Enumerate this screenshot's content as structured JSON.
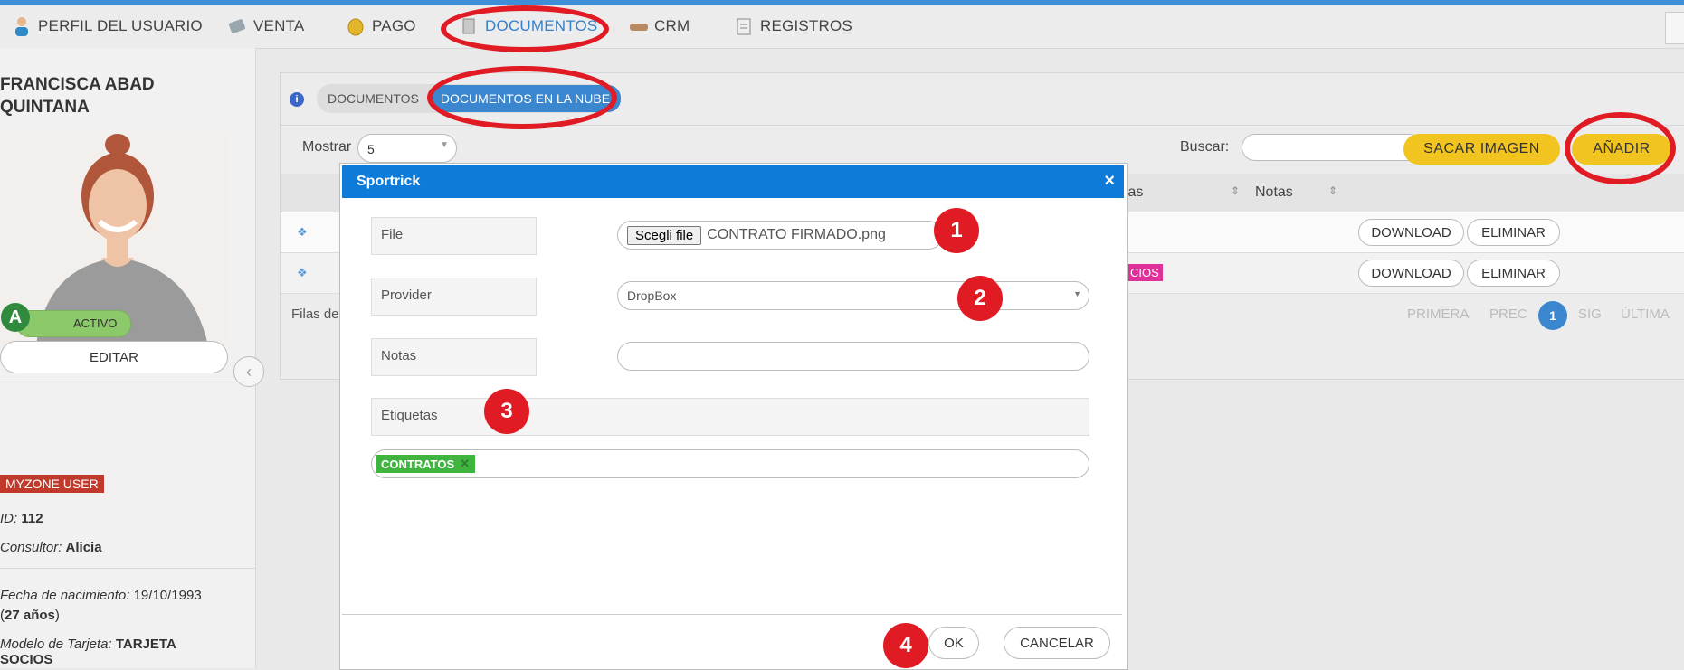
{
  "nav": {
    "items": [
      {
        "label": "PERFIL DEL USUARIO",
        "icon": "user-icon"
      },
      {
        "label": "VENTA",
        "icon": "sale-icon"
      },
      {
        "label": "PAGO",
        "icon": "coin-icon"
      },
      {
        "label": "DOCUMENTOS",
        "icon": "document-icon"
      },
      {
        "label": "CRM",
        "icon": "handshake-icon"
      },
      {
        "label": "REGISTROS",
        "icon": "log-icon"
      }
    ]
  },
  "user": {
    "name": "FRANCISCA ABAD QUINTANA",
    "avatar_letter": "A",
    "status": "ACTIVO",
    "edit_label": "EDITAR",
    "tag": "MYZONE USER",
    "id_label": "ID:",
    "id_value": "112",
    "consultor_label": "Consultor:",
    "consultor_value": "Alicia",
    "birth_label": "Fecha de nacimiento:",
    "birth_value": "19/10/1993",
    "age_value": "27 años",
    "card_label": "Modelo de Tarjeta:",
    "card_value": "TARJETA SOCIOS"
  },
  "main": {
    "tabs": [
      "DOCUMENTOS",
      "DOCUMENTOS EN LA NUBE"
    ],
    "show_label": "Mostrar",
    "show_value": "5",
    "search_label": "Buscar:",
    "btn_snapshot": "SACAR IMAGEN",
    "btn_add": "AÑADIR",
    "columns": [
      "tas",
      "Notas"
    ],
    "rows": [
      {
        "tag": "",
        "download": "DOWNLOAD",
        "delete": "ELIMINAR"
      },
      {
        "tag": "CIOS",
        "download": "DOWNLOAD",
        "delete": "ELIMINAR"
      }
    ],
    "rows_label": "Filas de",
    "pager": {
      "first": "PRIMERA",
      "prev": "PREC",
      "current": "1",
      "next": "SIG",
      "last": "ÚLTIMA"
    }
  },
  "modal": {
    "title": "Sportrick",
    "close": "×",
    "file_label": "File",
    "file_button": "Scegli file",
    "file_name": "CONTRATO FIRMADO.png",
    "provider_label": "Provider",
    "provider_value": "DropBox",
    "notes_label": "Notas",
    "tags_label": "Etiquetas",
    "tag_chip": "CONTRATOS",
    "ok": "OK",
    "cancel": "CANCELAR"
  },
  "annotations": [
    "1",
    "2",
    "3",
    "4"
  ],
  "colors": {
    "accent": "#0e7bd9",
    "annotation": "#e01b24",
    "add_button": "#f2c41f",
    "active_status": "#8cc96a"
  }
}
